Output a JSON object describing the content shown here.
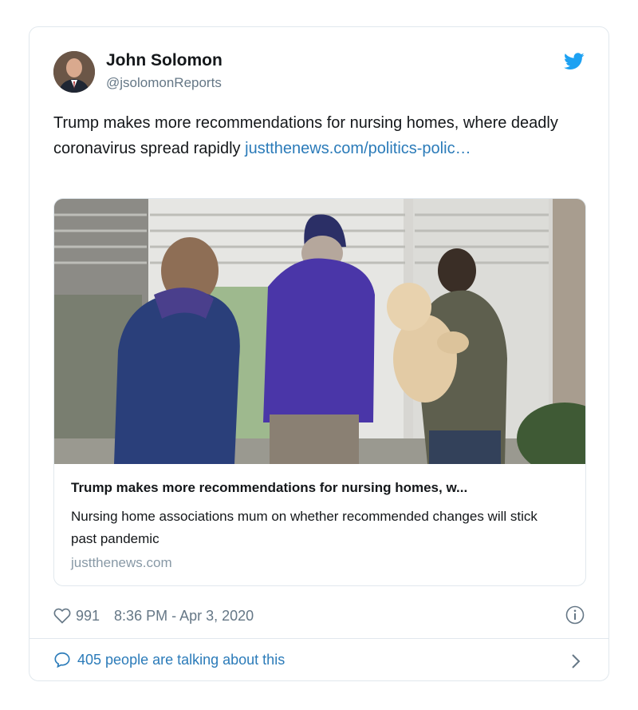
{
  "tweet": {
    "author_name": "John Solomon",
    "author_handle": "@jsolomonReports",
    "text": "Trump makes more recommendations for nursing homes, where deadly coronavirus spread rapidly ",
    "link_text": "justthenews.com/politics-polic…",
    "likes": "991",
    "timestamp": "8:36 PM - Apr 3, 2020",
    "talking": "405 people are talking about this"
  },
  "link_card": {
    "title": "Trump makes more recommendations for nursing homes, w...",
    "description": "Nursing home associations mum on whether recommended changes will stick past pandemic",
    "domain": "justthenews.com"
  },
  "colors": {
    "brand_blue": "#1da1f2",
    "link_blue": "#2b7bb9",
    "muted": "#657786",
    "border": "#e1e8ed"
  },
  "icons": [
    "twitter-bird-icon",
    "heart-icon",
    "info-icon",
    "comment-bubble-icon",
    "chevron-right-icon"
  ]
}
